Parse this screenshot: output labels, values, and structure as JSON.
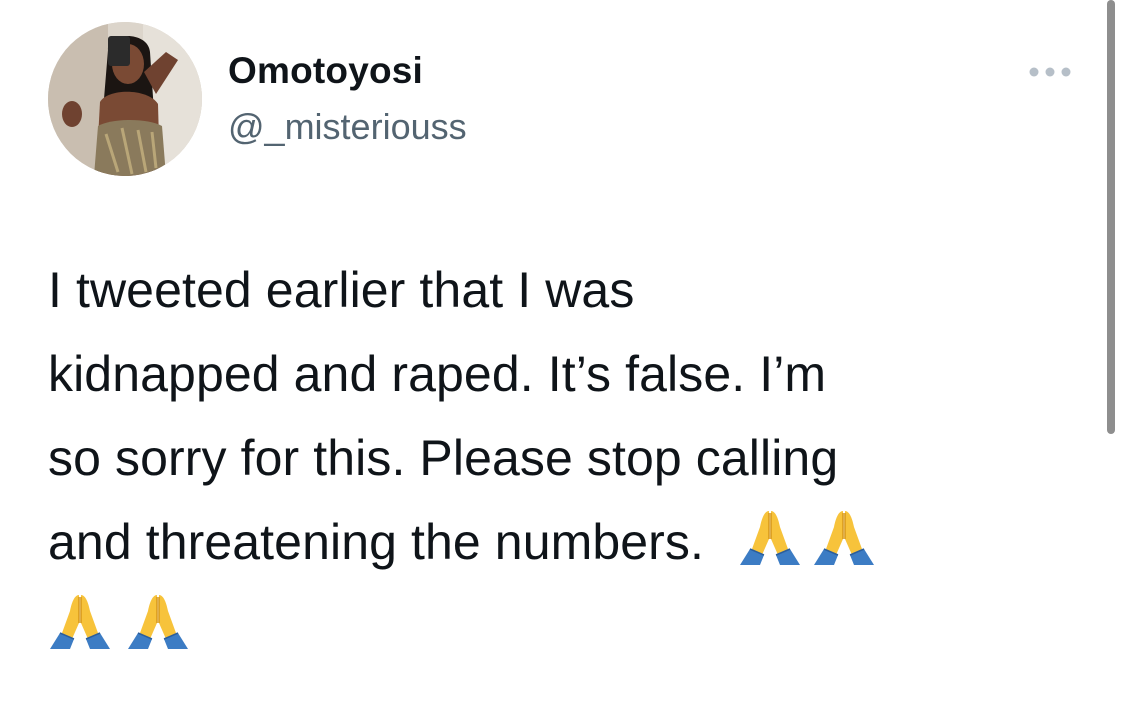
{
  "tweet": {
    "author": {
      "display_name": "Omotoyosi",
      "handle": "@_misteriouss",
      "avatar_icon": "profile-photo"
    },
    "more_icon": "ellipsis-icon",
    "text_lines": [
      "I tweeted earlier that I was",
      "kidnapped and raped. It’s false. I’m",
      "so sorry for this. Please stop calling",
      "and threatening the numbers."
    ],
    "emoji": [
      "🙏",
      "🙏",
      "🙏",
      "🙏"
    ],
    "emoji_icon": "folded-hands-icon"
  },
  "colors": {
    "text": "#0f1419",
    "secondary": "#536471",
    "background": "#ffffff",
    "scrollbar": "#8e8e8e"
  }
}
